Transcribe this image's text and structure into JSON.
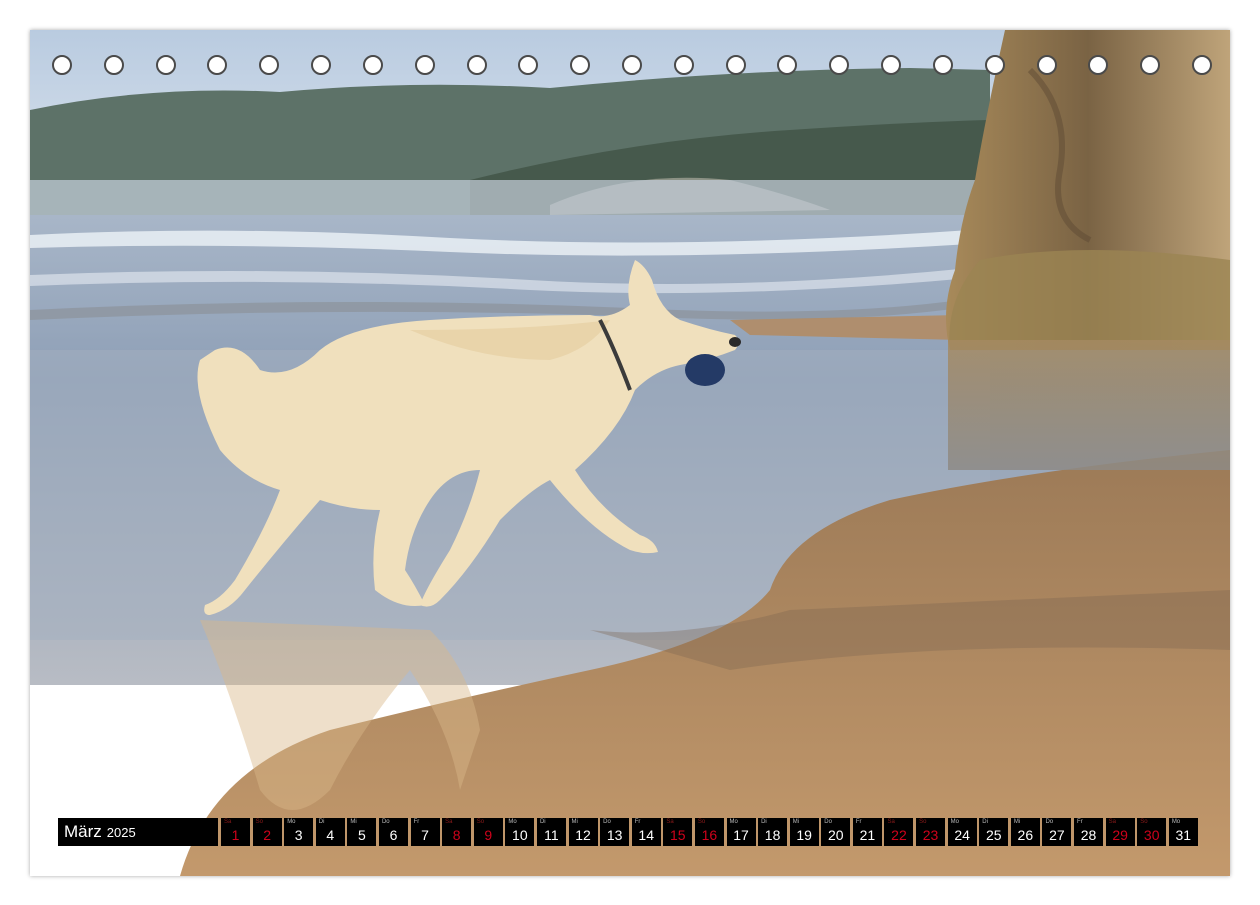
{
  "calendar": {
    "month": "März",
    "year": "2025",
    "days": [
      {
        "num": "1",
        "wd": "Sa",
        "weekend": true
      },
      {
        "num": "2",
        "wd": "So",
        "weekend": true
      },
      {
        "num": "3",
        "wd": "Mo",
        "weekend": false
      },
      {
        "num": "4",
        "wd": "Di",
        "weekend": false
      },
      {
        "num": "5",
        "wd": "Mi",
        "weekend": false
      },
      {
        "num": "6",
        "wd": "Do",
        "weekend": false
      },
      {
        "num": "7",
        "wd": "Fr",
        "weekend": false
      },
      {
        "num": "8",
        "wd": "Sa",
        "weekend": true
      },
      {
        "num": "9",
        "wd": "So",
        "weekend": true
      },
      {
        "num": "10",
        "wd": "Mo",
        "weekend": false
      },
      {
        "num": "11",
        "wd": "Di",
        "weekend": false
      },
      {
        "num": "12",
        "wd": "Mi",
        "weekend": false
      },
      {
        "num": "13",
        "wd": "Do",
        "weekend": false
      },
      {
        "num": "14",
        "wd": "Fr",
        "weekend": false
      },
      {
        "num": "15",
        "wd": "Sa",
        "weekend": true
      },
      {
        "num": "16",
        "wd": "So",
        "weekend": true
      },
      {
        "num": "17",
        "wd": "Mo",
        "weekend": false
      },
      {
        "num": "18",
        "wd": "Di",
        "weekend": false
      },
      {
        "num": "19",
        "wd": "Mi",
        "weekend": false
      },
      {
        "num": "20",
        "wd": "Do",
        "weekend": false
      },
      {
        "num": "21",
        "wd": "Fr",
        "weekend": false
      },
      {
        "num": "22",
        "wd": "Sa",
        "weekend": true
      },
      {
        "num": "23",
        "wd": "So",
        "weekend": true
      },
      {
        "num": "24",
        "wd": "Mo",
        "weekend": false
      },
      {
        "num": "25",
        "wd": "Di",
        "weekend": false
      },
      {
        "num": "26",
        "wd": "Mi",
        "weekend": false
      },
      {
        "num": "27",
        "wd": "Do",
        "weekend": false
      },
      {
        "num": "28",
        "wd": "Fr",
        "weekend": false
      },
      {
        "num": "29",
        "wd": "Sa",
        "weekend": true
      },
      {
        "num": "30",
        "wd": "So",
        "weekend": true
      },
      {
        "num": "31",
        "wd": "Mo",
        "weekend": false
      }
    ]
  },
  "colors": {
    "weekend_number": "#d0021b",
    "bar_background": "#000000",
    "sand": "#b48a5e",
    "water": "#9aa9bf",
    "sky": "#c9d6e6",
    "dog": "#f1e2c0"
  },
  "binding": {
    "hole_count": 23
  }
}
